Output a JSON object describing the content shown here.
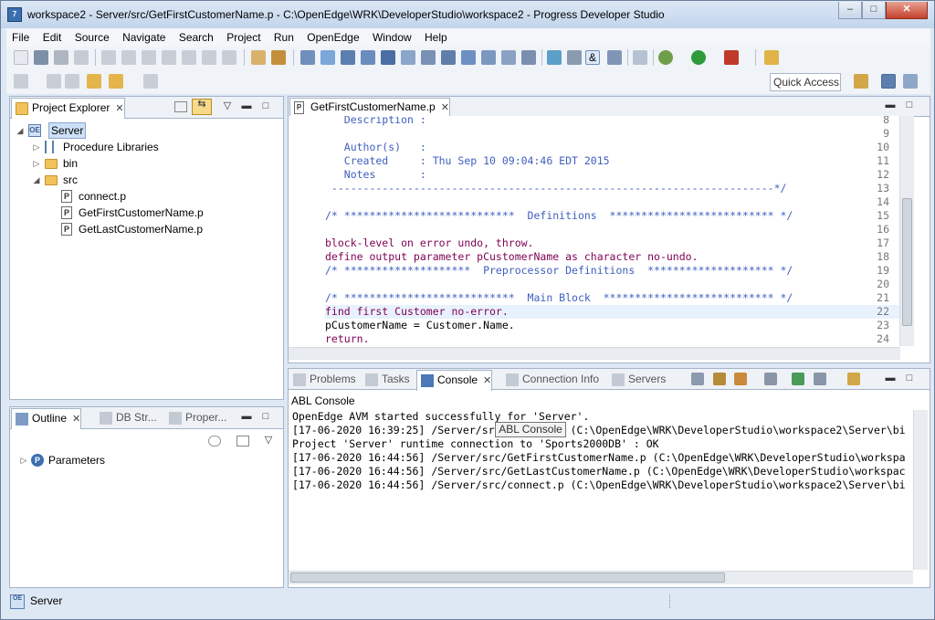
{
  "window": {
    "title": "workspace2 - Server/src/GetFirstCustomerName.p - C:\\OpenEdge\\WRK\\DeveloperStudio\\workspace2 - Progress Developer Studio",
    "app_icon_text": "7",
    "controls": {
      "minimize": "–",
      "maximize": "□",
      "close": "✕"
    }
  },
  "menu": [
    "File",
    "Edit",
    "Source",
    "Navigate",
    "Search",
    "Project",
    "Run",
    "OpenEdge",
    "Window",
    "Help"
  ],
  "quick_access": "Quick Access",
  "project_explorer": {
    "tab_label": "Project Explorer",
    "tree": [
      {
        "label": "Server",
        "level": 0,
        "expanded": true,
        "icon": "oe-project-icon"
      },
      {
        "label": "Procedure Libraries",
        "level": 1,
        "expanded": false,
        "icon": "library-icon"
      },
      {
        "label": "bin",
        "level": 1,
        "expanded": false,
        "icon": "folder-icon"
      },
      {
        "label": "src",
        "level": 1,
        "expanded": true,
        "icon": "folder-icon"
      },
      {
        "label": "connect.p",
        "level": 2,
        "icon": "procedure-file-icon"
      },
      {
        "label": "GetFirstCustomerName.p",
        "level": 2,
        "icon": "procedure-file-icon"
      },
      {
        "label": "GetLastCustomerName.p",
        "level": 2,
        "icon": "procedure-file-icon"
      }
    ]
  },
  "outline": {
    "tabs": [
      {
        "label": "Outline",
        "active": true
      },
      {
        "label": "DB Str...",
        "active": false
      },
      {
        "label": "Proper...",
        "active": false
      }
    ],
    "items": [
      {
        "label": "Parameters",
        "icon": "parameters-icon"
      }
    ]
  },
  "editor": {
    "tab_label": "GetFirstCustomerName.p",
    "current_line": 22,
    "lines": [
      {
        "n": "8",
        "t": "   Description :"
      },
      {
        "n": "9",
        "t": ""
      },
      {
        "n": "10",
        "t": "   Author(s)   :"
      },
      {
        "n": "11",
        "t": "   Created     : Thu Sep 10 09:04:46 EDT 2015"
      },
      {
        "n": "12",
        "t": "   Notes       :"
      },
      {
        "n": "13",
        "t": " ----------------------------------------------------------------------*/"
      },
      {
        "n": "14",
        "t": ""
      },
      {
        "n": "15",
        "t": "/* ***************************  Definitions  ************************** */"
      },
      {
        "n": "16",
        "t": ""
      },
      {
        "n": "17",
        "t": "block-level on error undo, throw."
      },
      {
        "n": "18",
        "t": "define output parameter pCustomerName as character no-undo."
      },
      {
        "n": "19",
        "t": "/* ********************  Preprocessor Definitions  ******************** */"
      },
      {
        "n": "20",
        "t": ""
      },
      {
        "n": "21",
        "t": "/* ***************************  Main Block  *************************** */"
      },
      {
        "n": "22",
        "t": "find first Customer no-error."
      },
      {
        "n": "23",
        "t": "pCustomerName = Customer.Name."
      },
      {
        "n": "24",
        "t": "return."
      }
    ]
  },
  "bottom_panel": {
    "tabs": [
      {
        "label": "Problems",
        "active": false
      },
      {
        "label": "Tasks",
        "active": false
      },
      {
        "label": "Console",
        "active": true
      },
      {
        "label": "Connection Info",
        "active": false
      },
      {
        "label": "Servers",
        "active": false
      }
    ],
    "console_name": "ABL Console",
    "tooltip": "ABL Console",
    "lines": [
      "OpenEdge AVM started successfully for 'Server'.",
      "[17-06-2020 16:39:25] /Server/src/connect.p (C:\\OpenEdge\\WRK\\DeveloperStudio\\workspace2\\Server\\bi",
      "Project 'Server' runtime connection to 'Sports2000DB' : OK",
      "[17-06-2020 16:44:56] /Server/src/GetFirstCustomerName.p (C:\\OpenEdge\\WRK\\DeveloperStudio\\workspa",
      "[17-06-2020 16:44:56] /Server/src/GetLastCustomerName.p (C:\\OpenEdge\\WRK\\DeveloperStudio\\workspac",
      "[17-06-2020 16:44:56] /Server/src/connect.p (C:\\OpenEdge\\WRK\\DeveloperStudio\\workspace2\\Server\\bi"
    ]
  },
  "status_bar": {
    "project": "Server"
  },
  "colors": {
    "comment": "#3f5fbf",
    "keyword": "#7f0055",
    "type": "#c86414",
    "current_line": "#e8f2fe",
    "chrome": "#dde8f4"
  }
}
